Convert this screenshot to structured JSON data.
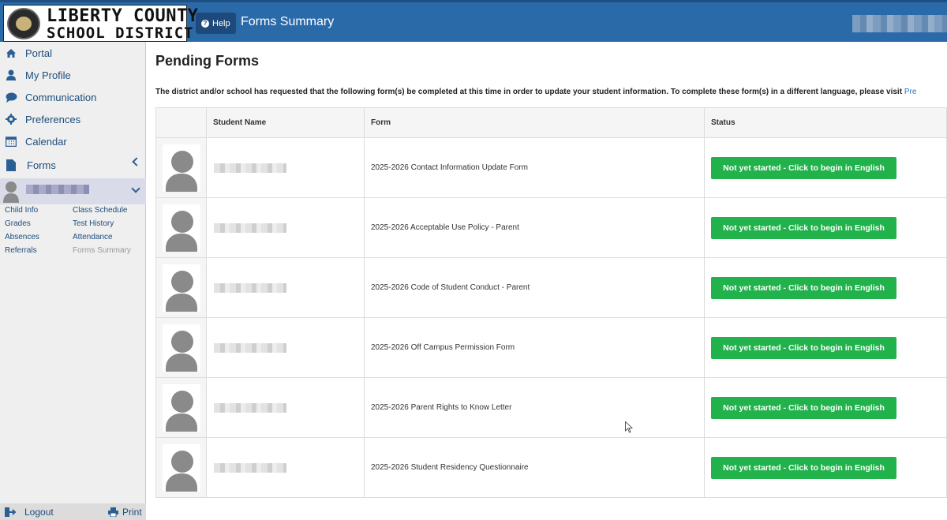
{
  "header": {
    "logo_line1": "LIBERTY COUNTY",
    "logo_line2": "SCHOOL DISTRICT",
    "help_label": "Help",
    "title": "Forms Summary"
  },
  "sidebar": {
    "items": [
      {
        "label": "Portal",
        "icon": "home-icon"
      },
      {
        "label": "My Profile",
        "icon": "user-icon"
      },
      {
        "label": "Communication",
        "icon": "chat-icon"
      },
      {
        "label": "Preferences",
        "icon": "gear-icon"
      },
      {
        "label": "Calendar",
        "icon": "calendar-icon"
      },
      {
        "label": "Forms",
        "icon": "document-icon"
      }
    ],
    "student_links": [
      {
        "label": "Child Info"
      },
      {
        "label": "Class Schedule"
      },
      {
        "label": "Grades"
      },
      {
        "label": "Test History"
      },
      {
        "label": "Absences"
      },
      {
        "label": "Attendance"
      },
      {
        "label": "Referrals"
      },
      {
        "label": "Forms Summary"
      }
    ],
    "logout_label": "Logout",
    "print_label": "Print"
  },
  "main": {
    "title": "Pending Forms",
    "intro": "The district and/or school has requested that the following form(s) be completed at this time in order to update your student information. To complete these form(s) in a different language, please visit ",
    "intro_link": "Pre",
    "columns": [
      "Student Name",
      "Form",
      "Status"
    ],
    "rows": [
      {
        "form": "2025-2026 Contact Information Update Form",
        "status": "Not yet started - Click to begin in English"
      },
      {
        "form": "2025-2026 Acceptable Use Policy - Parent",
        "status": "Not yet started - Click to begin in English"
      },
      {
        "form": "2025-2026 Code of Student Conduct - Parent",
        "status": "Not yet started - Click to begin in English"
      },
      {
        "form": "2025-2026 Off Campus Permission Form",
        "status": "Not yet started - Click to begin in English"
      },
      {
        "form": "2025-2026 Parent Rights to Know Letter",
        "status": "Not yet started - Click to begin in English"
      },
      {
        "form": "2025-2026 Student Residency Questionnaire",
        "status": "Not yet started - Click to begin in English"
      }
    ]
  },
  "colors": {
    "header_bg": "#2b6aa8",
    "status_button": "#22b24c",
    "link": "#1e4d7c"
  }
}
